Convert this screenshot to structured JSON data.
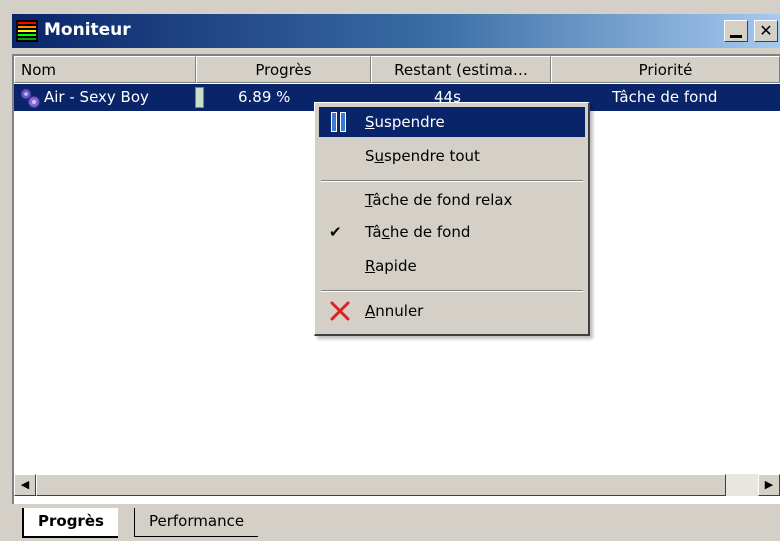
{
  "window": {
    "title": "Moniteur",
    "minimize_glyph": "",
    "close_glyph": "✕"
  },
  "columns": [
    "Nom",
    "Progrès",
    "Restant (estima…",
    "Priorité"
  ],
  "rows": [
    {
      "name": "Air - Sexy Boy",
      "progress": "6.89 %",
      "progress_fraction": 0.0689,
      "remaining": "44s",
      "priority": "Tâche de fond",
      "selected": true
    }
  ],
  "context_menu": {
    "items": [
      {
        "label": "Suspendre",
        "mnemonic": "S",
        "icon": "pause-icon",
        "highlighted": true
      },
      {
        "label": "Suspendre tout",
        "mnemonic": "u"
      },
      {
        "label": "Tâche de fond relax",
        "mnemonic": "T"
      },
      {
        "label": "Tâche de fond",
        "mnemonic": "c",
        "checked": true
      },
      {
        "label": "Rapide",
        "mnemonic": "R"
      },
      {
        "label": "Annuler",
        "mnemonic": "A",
        "icon": "cancel-x-icon"
      }
    ]
  },
  "tabs": [
    {
      "label": "Progrès",
      "active": true
    },
    {
      "label": "Performance",
      "active": false
    }
  ],
  "colors": {
    "selection": "#0a246a",
    "face": "#d4d0c8",
    "title_gradient_start": "#0a246a",
    "title_gradient_end": "#a6caf0",
    "cancel_red": "#e02020"
  }
}
